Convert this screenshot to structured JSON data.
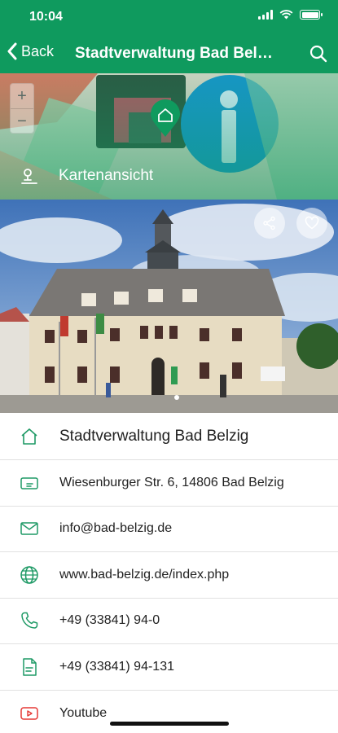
{
  "status_bar": {
    "time": "10:04"
  },
  "header": {
    "back_label": "Back",
    "title": "Stadtverwaltung Bad Belzig"
  },
  "map": {
    "label": "Kartenansicht",
    "zoom_in": "+",
    "zoom_out": "−"
  },
  "info_rows": [
    {
      "icon": "home-icon",
      "label": "Stadtverwaltung Bad Belzig"
    },
    {
      "icon": "address-card-icon",
      "label": "Wiesenburger Str. 6, 14806 Bad Belzig"
    },
    {
      "icon": "mail-icon",
      "label": "info@bad-belzig.de"
    },
    {
      "icon": "globe-icon",
      "label": "www.bad-belzig.de/index.php"
    },
    {
      "icon": "phone-icon",
      "label": "+49 (33841) 94-0"
    },
    {
      "icon": "fax-document-icon",
      "label": "+49 (33841) 94-131"
    },
    {
      "icon": "youtube-icon",
      "label": "Youtube"
    }
  ],
  "colors": {
    "brand_green": "#0f9a5e",
    "icon_green": "#1f9a66",
    "youtube_red": "#e53935"
  }
}
